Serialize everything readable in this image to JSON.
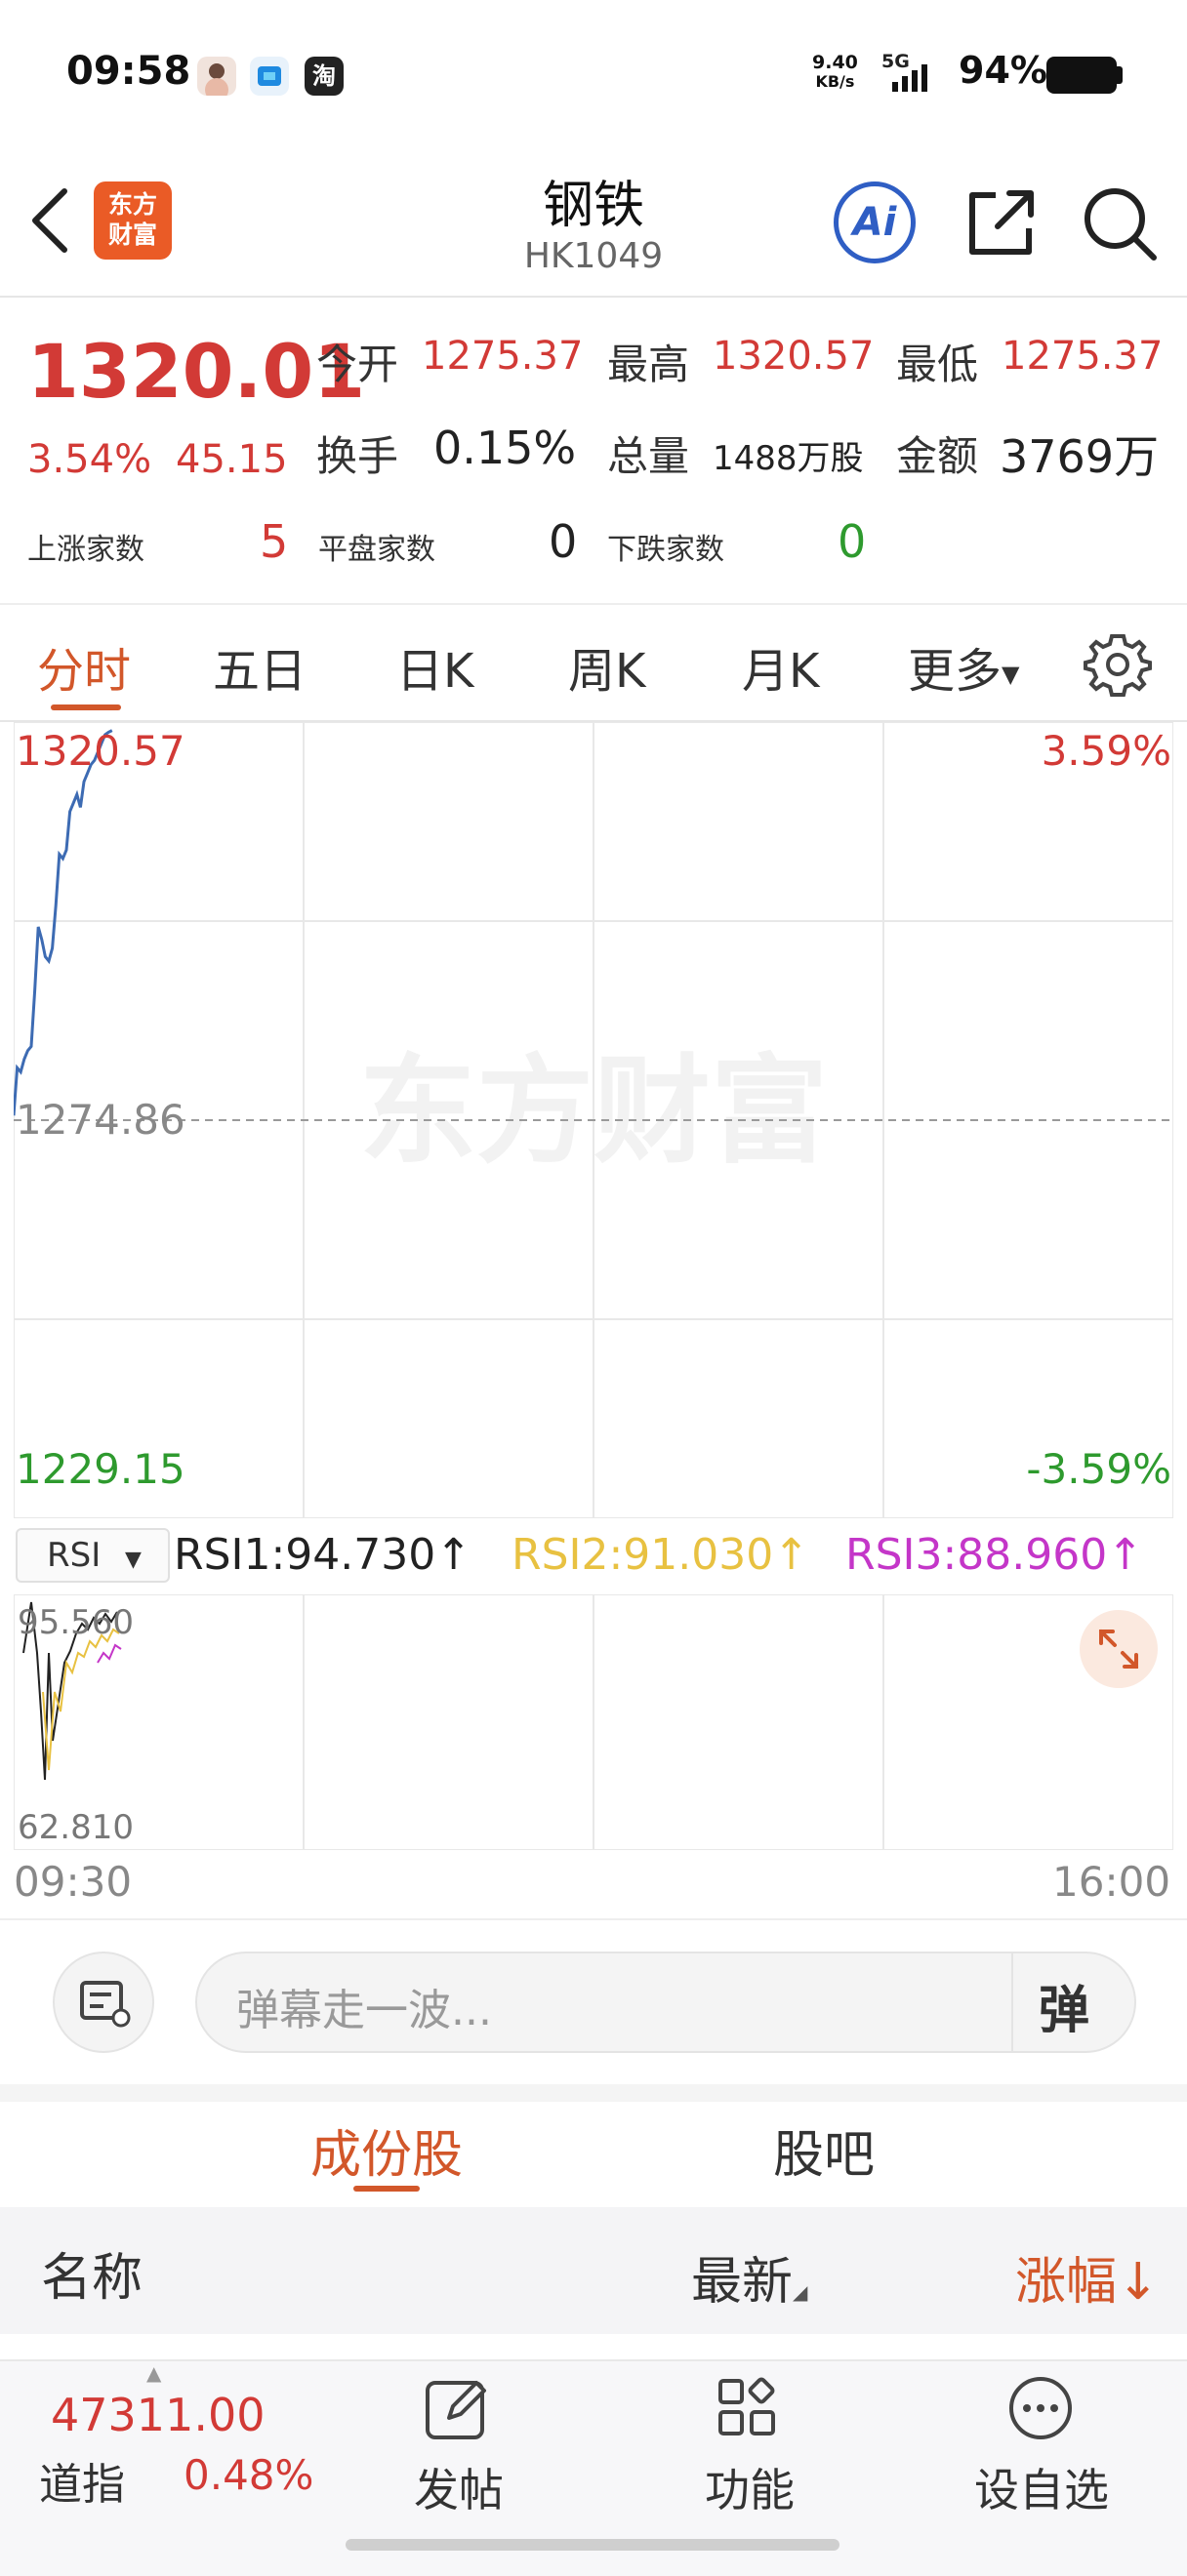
{
  "status_bar": {
    "time": "09:58",
    "net_speed_value": "9.40",
    "net_speed_unit": "KB/s",
    "network": "5G",
    "battery": "94%",
    "app_icons": [
      "avatar-app-icon",
      "blue-app-icon",
      "taobao-icon"
    ],
    "taobao_glyph": "淘"
  },
  "header": {
    "logo_line1": "东方",
    "logo_line2": "财富",
    "title": "钢铁",
    "code": "HK1049",
    "ai_label": "Ai"
  },
  "quote": {
    "price": "1320.01",
    "change_pct": "3.54%",
    "change": "45.15",
    "open_label": "今开",
    "open": "1275.37",
    "high_label": "最高",
    "high": "1320.57",
    "low_label": "最低",
    "low": "1275.37",
    "turnover_label": "换手",
    "turnover": "0.15%",
    "volume_label": "总量",
    "volume": "1488万股",
    "amount_label": "金额",
    "amount": "3769万",
    "up_label": "上涨家数",
    "up_count": "5",
    "flat_label": "平盘家数",
    "flat_count": "0",
    "down_label": "下跌家数",
    "down_count": "0"
  },
  "tabs": [
    "分时",
    "五日",
    "日K",
    "周K",
    "月K",
    "更多"
  ],
  "chart": {
    "high_price": "1320.57",
    "high_pct": "3.59%",
    "base_price": "1274.86",
    "low_price": "1229.15",
    "low_pct": "-3.59%",
    "watermark": "东方财富",
    "time_start": "09:30",
    "time_end": "16:00",
    "rsi_selector": "RSI",
    "rsi1": "RSI1:94.730",
    "rsi2": "RSI2:91.030",
    "rsi3": "RSI3:88.960",
    "rsi_max": "95.560",
    "rsi_min": "62.810",
    "colors": {
      "up": "#d23a36",
      "down": "#2e9a2e",
      "line": "#3d6bb3",
      "rsi2": "#e8c141",
      "rsi3": "#c436c8"
    }
  },
  "chart_data": {
    "type": "line",
    "x": [
      "09:30",
      "09:31",
      "09:32",
      "09:33",
      "09:34",
      "09:35",
      "09:36",
      "09:37",
      "09:38",
      "09:39",
      "09:40",
      "09:41",
      "09:42",
      "09:43",
      "09:44",
      "09:45",
      "09:46",
      "09:47",
      "09:48",
      "09:49",
      "09:50",
      "09:51",
      "09:52",
      "09:53",
      "09:54",
      "09:55",
      "09:56",
      "09:57",
      "09:58"
    ],
    "series": [
      {
        "values": [
          1275.4,
          1281.0,
          1280.5,
          1282.0,
          1283.0,
          1283.5,
          1290.0,
          1297.5,
          1296.0,
          1294.0,
          1293.5,
          1295.0,
          1300.0,
          1306.0,
          1305.5,
          1306.5,
          1311.0,
          1312.0,
          1313.0,
          1311.5,
          1314.5,
          1315.5,
          1316.5,
          1317.0,
          1318.0,
          1319.0,
          1320.0,
          1320.3,
          1320.5
        ]
      }
    ],
    "ylim": [
      1229.15,
      1320.57
    ],
    "base": 1274.86,
    "xlim": [
      "09:30",
      "16:00"
    ]
  },
  "danmaku": {
    "placeholder": "弹幕走一波...",
    "button": "弹"
  },
  "subtabs": [
    "成份股",
    "股吧"
  ],
  "table_header": {
    "name": "名称",
    "latest": "最新",
    "change": "涨幅↓"
  },
  "bottom_nav": {
    "index_value": "47311.00",
    "index_name": "道指",
    "index_pct": "0.48%",
    "items": [
      "发帖",
      "功能",
      "设自选"
    ]
  }
}
